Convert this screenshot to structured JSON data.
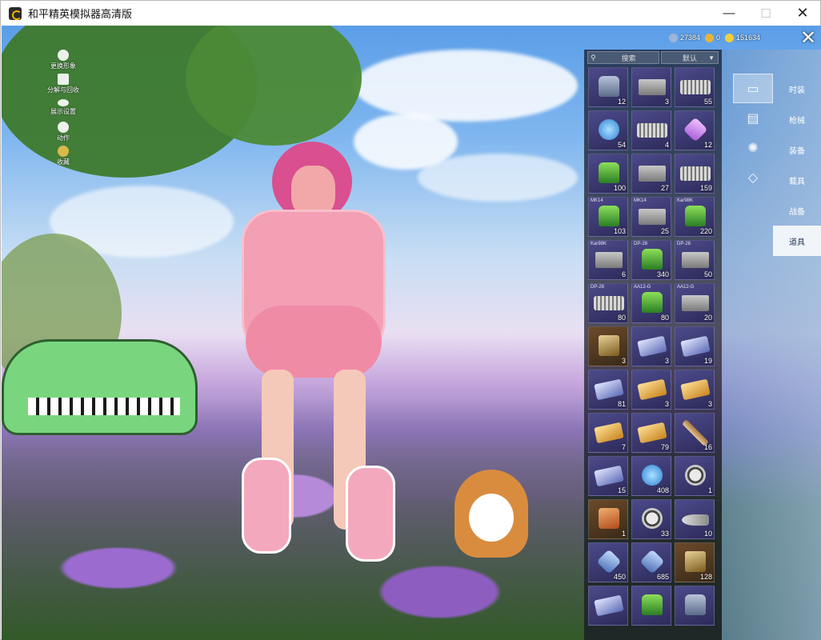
{
  "window": {
    "title": "和平精英模拟器高清版",
    "min_icon": "minimize-icon",
    "max_icon": "maximize-icon",
    "close_icon": "close-icon"
  },
  "left_menu": [
    {
      "label": "更换形象",
      "icon": "avatar-icon"
    },
    {
      "label": "分解与回收",
      "icon": "puzzle-icon"
    },
    {
      "label": "展示设置",
      "icon": "eye-icon"
    },
    {
      "label": "动作",
      "icon": "figure-icon"
    },
    {
      "label": "收藏",
      "icon": "badge-icon"
    }
  ],
  "currency": [
    {
      "icon": "cube-coin-icon",
      "value": "27384",
      "color": "#9fb4d6"
    },
    {
      "icon": "gold-coin-icon",
      "value": "0",
      "color": "#e6b43a"
    },
    {
      "icon": "bp-coin-icon",
      "value": "151634",
      "color": "#f1cf3a"
    }
  ],
  "inventory": {
    "search_placeholder": "搜索",
    "sort_label": "默认",
    "items": [
      {
        "name": "",
        "count": "12",
        "glyph": "can",
        "tier": "purple"
      },
      {
        "name": "",
        "count": "3",
        "glyph": "box",
        "tier": "purple"
      },
      {
        "name": "",
        "count": "55",
        "glyph": "spring",
        "tier": "purple"
      },
      {
        "name": "",
        "count": "54",
        "glyph": "orb",
        "tier": "purple"
      },
      {
        "name": "",
        "count": "4",
        "glyph": "spring",
        "tier": "purple"
      },
      {
        "name": "",
        "count": "12",
        "glyph": "crystal",
        "tier": "purple"
      },
      {
        "name": "",
        "count": "100",
        "glyph": "green",
        "tier": "purple"
      },
      {
        "name": "",
        "count": "27",
        "glyph": "box",
        "tier": "purple"
      },
      {
        "name": "",
        "count": "159",
        "glyph": "spring",
        "tier": "purple"
      },
      {
        "name": "MK14",
        "count": "103",
        "glyph": "green",
        "tier": "purple"
      },
      {
        "name": "MK14",
        "count": "25",
        "glyph": "box",
        "tier": "purple"
      },
      {
        "name": "Kar98K",
        "count": "220",
        "glyph": "green",
        "tier": "purple"
      },
      {
        "name": "Kar98K",
        "count": "6",
        "glyph": "box",
        "tier": "purple"
      },
      {
        "name": "DP-28",
        "count": "340",
        "glyph": "green",
        "tier": "purple"
      },
      {
        "name": "DP-28",
        "count": "50",
        "glyph": "box",
        "tier": "purple"
      },
      {
        "name": "DP-28",
        "count": "80",
        "glyph": "spring",
        "tier": "purple"
      },
      {
        "name": "AA12-G",
        "count": "80",
        "glyph": "green",
        "tier": "purple"
      },
      {
        "name": "AA12-G",
        "count": "20",
        "glyph": "box",
        "tier": "purple"
      },
      {
        "name": "",
        "count": "3",
        "glyph": "book",
        "tier": "gold"
      },
      {
        "name": "",
        "count": "3",
        "glyph": "card",
        "tier": "purple"
      },
      {
        "name": "",
        "count": "19",
        "glyph": "card",
        "tier": "purple"
      },
      {
        "name": "",
        "count": "81",
        "glyph": "card",
        "tier": "purple"
      },
      {
        "name": "",
        "count": "3",
        "glyph": "card-gold",
        "tier": "purple"
      },
      {
        "name": "",
        "count": "3",
        "glyph": "card-gold",
        "tier": "purple"
      },
      {
        "name": "",
        "count": "7",
        "glyph": "card-gold",
        "tier": "purple"
      },
      {
        "name": "",
        "count": "79",
        "glyph": "card-gold",
        "tier": "purple"
      },
      {
        "name": "",
        "count": "16",
        "glyph": "stick",
        "tier": "purple"
      },
      {
        "name": "",
        "count": "15",
        "glyph": "card",
        "tier": "purple"
      },
      {
        "name": "",
        "count": "408",
        "glyph": "orb",
        "tier": "purple"
      },
      {
        "name": "",
        "count": "1",
        "glyph": "coin",
        "tier": "purple"
      },
      {
        "name": "",
        "count": "1",
        "glyph": "medal",
        "tier": "gold"
      },
      {
        "name": "",
        "count": "33",
        "glyph": "coin",
        "tier": "purple"
      },
      {
        "name": "",
        "count": "10",
        "glyph": "key",
        "tier": "purple"
      },
      {
        "name": "",
        "count": "450",
        "glyph": "diamond",
        "tier": "purple"
      },
      {
        "name": "",
        "count": "685",
        "glyph": "diamond",
        "tier": "purple"
      },
      {
        "name": "",
        "count": "128",
        "glyph": "book",
        "tier": "gold"
      },
      {
        "name": "",
        "count": "",
        "glyph": "card",
        "tier": "purple"
      },
      {
        "name": "",
        "count": "",
        "glyph": "green",
        "tier": "purple"
      },
      {
        "name": "",
        "count": "",
        "glyph": "can",
        "tier": "purple"
      }
    ]
  },
  "side_icons": [
    {
      "icon": "card-icon",
      "active": true
    },
    {
      "icon": "briefcase-icon",
      "active": false
    },
    {
      "icon": "sparkle-icon",
      "active": false
    },
    {
      "icon": "ticket-icon",
      "active": false
    }
  ],
  "categories": [
    {
      "label": "时装",
      "active": false
    },
    {
      "label": "枪械",
      "active": false
    },
    {
      "label": "装备",
      "active": false
    },
    {
      "label": "载具",
      "active": false
    },
    {
      "label": "战备",
      "active": false
    },
    {
      "label": "道具",
      "active": true
    }
  ]
}
